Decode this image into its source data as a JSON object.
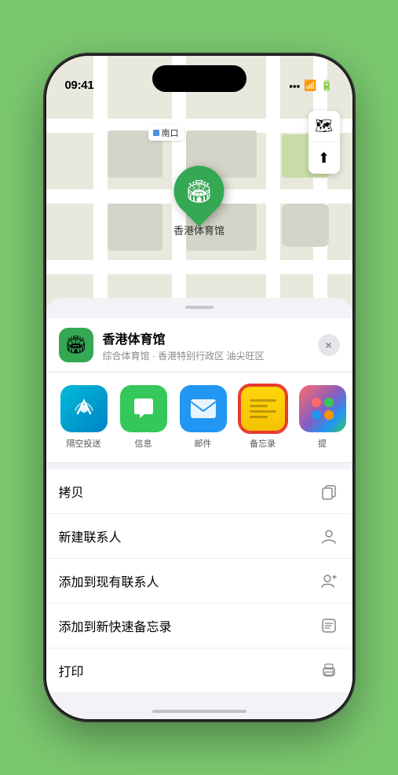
{
  "status_bar": {
    "time": "09:41",
    "location_arrow": "▶"
  },
  "map": {
    "label": "南口",
    "pin_label": "香港体育馆",
    "pin_emoji": "🏟"
  },
  "location_header": {
    "name": "香港体育馆",
    "description": "综合体育馆 · 香港特别行政区 油尖旺区",
    "close_label": "×"
  },
  "share_actions": [
    {
      "id": "airdrop",
      "label": "隔空投送",
      "emoji": "📡"
    },
    {
      "id": "messages",
      "label": "信息",
      "emoji": "💬"
    },
    {
      "id": "mail",
      "label": "邮件",
      "emoji": "✉️"
    },
    {
      "id": "notes",
      "label": "备忘录",
      "emoji": ""
    },
    {
      "id": "more",
      "label": "提",
      "emoji": "⠿"
    }
  ],
  "menu_items": [
    {
      "id": "copy",
      "label": "拷贝",
      "icon": "copy"
    },
    {
      "id": "new-contact",
      "label": "新建联系人",
      "icon": "person"
    },
    {
      "id": "add-existing",
      "label": "添加到现有联系人",
      "icon": "person-add"
    },
    {
      "id": "add-notes",
      "label": "添加到新快速备忘录",
      "icon": "note"
    },
    {
      "id": "print",
      "label": "打印",
      "icon": "printer"
    }
  ]
}
